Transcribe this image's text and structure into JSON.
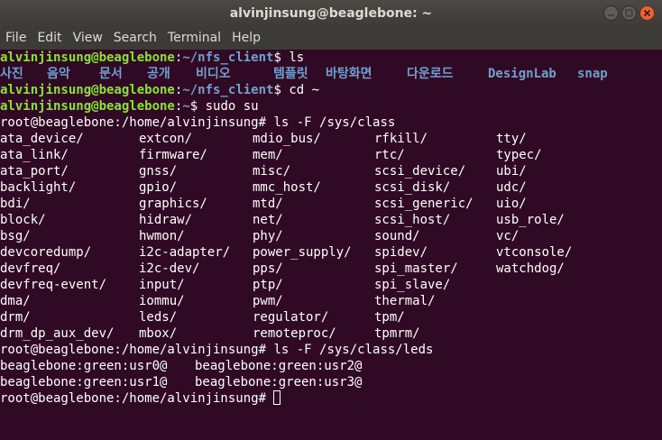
{
  "window": {
    "title": "alvinjinsung@beaglebone: ~"
  },
  "menu": [
    "File",
    "Edit",
    "View",
    "Search",
    "Terminal",
    "Help"
  ],
  "prompt_user": {
    "userhost": "alvinjinsung@beaglebone",
    "path_nfs": "~/nfs_client",
    "path_home": "~",
    "sep": ":",
    "end": "$ "
  },
  "cmds": {
    "ls": "ls",
    "cd": "cd ~",
    "sudo": "sudo su",
    "ls_class": "ls -F /sys/class",
    "ls_leds": "ls -F /sys/class/leds"
  },
  "ls_output": [
    "사진",
    "음악",
    "문서",
    "공개",
    "비디오",
    "템플릿",
    "바탕화면",
    "다운로드",
    "DesignLab",
    "snap"
  ],
  "root_prompt": "root@beaglebone:/home/alvinjinsung# ",
  "class_rows": [
    [
      "ata_device/",
      "extcon/",
      "mdio_bus/",
      "rfkill/",
      "tty/"
    ],
    [
      "ata_link/",
      "firmware/",
      "mem/",
      "rtc/",
      "typec/"
    ],
    [
      "ata_port/",
      "gnss/",
      "misc/",
      "scsi_device/",
      "ubi/"
    ],
    [
      "backlight/",
      "gpio/",
      "mmc_host/",
      "scsi_disk/",
      "udc/"
    ],
    [
      "bdi/",
      "graphics/",
      "mtd/",
      "scsi_generic/",
      "uio/"
    ],
    [
      "block/",
      "hidraw/",
      "net/",
      "scsi_host/",
      "usb_role/"
    ],
    [
      "bsg/",
      "hwmon/",
      "phy/",
      "sound/",
      "vc/"
    ],
    [
      "devcoredump/",
      "i2c-adapter/",
      "power_supply/",
      "spidev/",
      "vtconsole/"
    ],
    [
      "devfreq/",
      "i2c-dev/",
      "pps/",
      "spi_master/",
      "watchdog/"
    ],
    [
      "devfreq-event/",
      "input/",
      "ptp/",
      "spi_slave/",
      ""
    ],
    [
      "dma/",
      "iommu/",
      "pwm/",
      "thermal/",
      ""
    ],
    [
      "drm/",
      "leds/",
      "regulator/",
      "tpm/",
      ""
    ],
    [
      "drm_dp_aux_dev/",
      "mbox/",
      "remoteproc/",
      "tpmrm/",
      ""
    ]
  ],
  "leds_rows": [
    [
      "beaglebone:green:usr0@",
      "beaglebone:green:usr2@"
    ],
    [
      "beaglebone:green:usr1@",
      "beaglebone:green:usr3@"
    ]
  ]
}
